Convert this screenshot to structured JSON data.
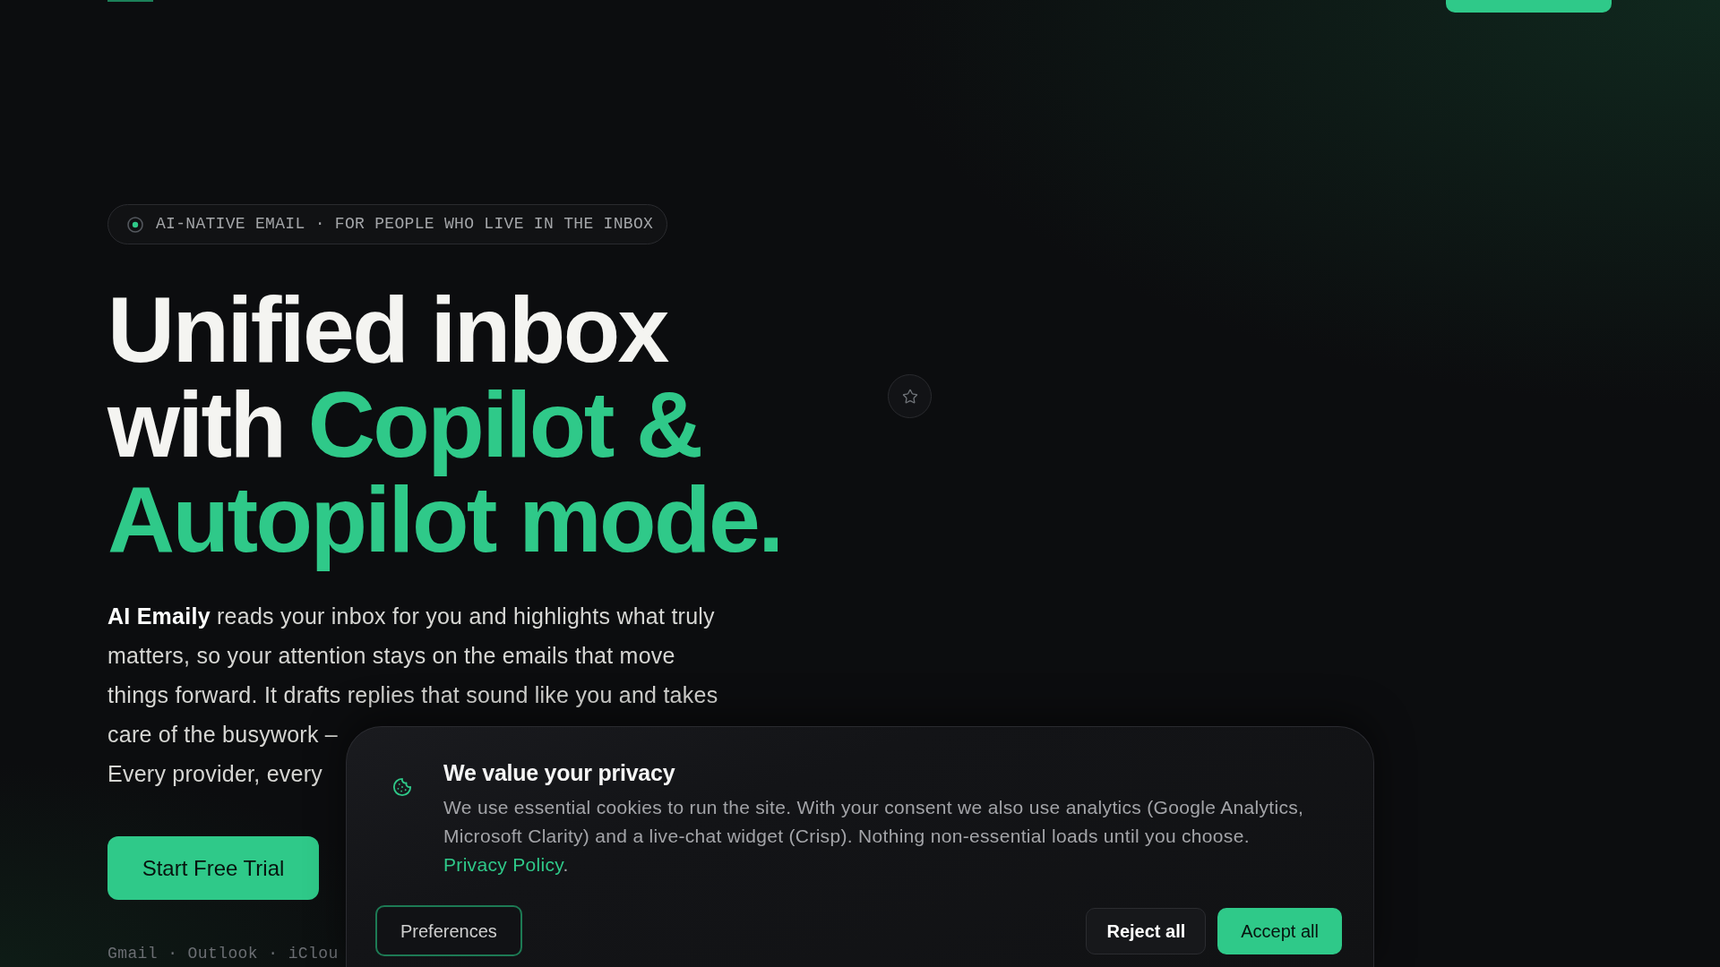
{
  "hero": {
    "badge": "AI-NATIVE EMAIL · FOR PEOPLE WHO LIVE IN THE INBOX",
    "headline": [
      {
        "text": "Unified inbox with",
        "highlighted": false
      },
      {
        "text": "Copilot & Autopilot mode.",
        "highlighted": true
      }
    ],
    "description": [
      "**AI Emaily** reads your inbox for you and highlights what truly matters, so your attention stays on the emails that move things forward. It drafts replies that sound like you and takes",
      "care of the busywork –",
      "Every provider, every"
    ],
    "cta": "Start Free Trial",
    "providers": "Gmail · Outlook · iClou"
  },
  "cookie_banner": {
    "title": "We value your privacy",
    "text": "We use essential cookies to run the site. With your consent we also use analytics (Google Analytics, Microsoft Clarity) and a live-chat widget (Crisp). Nothing non-essential loads until you choose.",
    "link": "Privacy Policy",
    "text_end": ".",
    "buttons": [
      {
        "label": "Preferences",
        "kind": "outline"
      },
      {
        "label": "Reject all",
        "kind": "secondary"
      },
      {
        "label": "Accept all",
        "kind": "primary"
      }
    ]
  }
}
